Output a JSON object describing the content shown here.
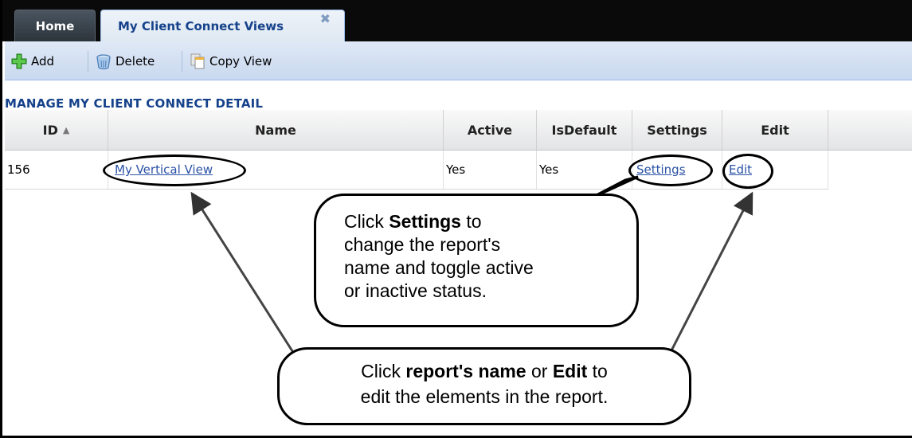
{
  "tabs": [
    {
      "label": "Home"
    },
    {
      "label": "My Client Connect Views",
      "close_glyph": "✖"
    }
  ],
  "toolbar": {
    "add_label": "Add",
    "delete_label": "Delete",
    "copy_label": "Copy View",
    "add_icon": "plus-icon",
    "delete_icon": "trash-icon",
    "copy_icon": "copy-icon"
  },
  "panel": {
    "title": "MANAGE MY CLIENT CONNECT DETAIL"
  },
  "grid": {
    "columns": [
      "ID",
      "Name",
      "Active",
      "IsDefault",
      "Settings",
      "Edit"
    ],
    "rows": [
      {
        "id": "156",
        "name": "My Vertical View",
        "active": "Yes",
        "is_default": "Yes",
        "settings": "Settings",
        "edit": "Edit"
      }
    ]
  },
  "callouts": {
    "settings": {
      "line1_pre": "Click ",
      "line1_bold": "Settings",
      "line1_post": " to",
      "line2": "change the report's",
      "line3": "name and toggle active",
      "line4": "or inactive status."
    },
    "edit": {
      "line1_pre": "Click ",
      "line1_bold": "report's name",
      "line1_mid": " or ",
      "line1_bold2": "Edit",
      "line1_post": "  to",
      "line2": "edit the elements in the report."
    }
  },
  "colors": {
    "tab_active_text": "#15428b",
    "link": "#2a52a5",
    "toolbar_bg": "#dfe8f6"
  }
}
